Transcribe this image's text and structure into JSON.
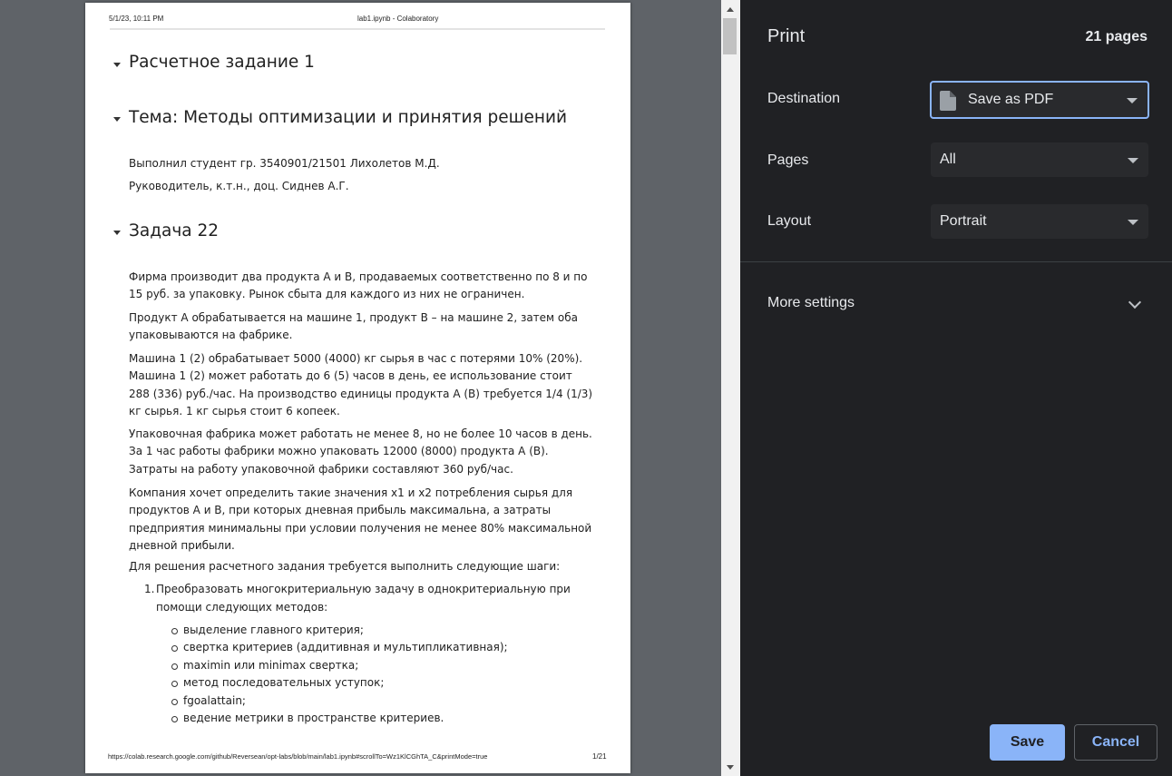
{
  "document": {
    "header_date": "5/1/23, 10:11 PM",
    "header_title": "lab1.ipynb - Colaboratory",
    "heading1": "Расчетное задание 1",
    "heading2": "Тема: Методы оптимизации и принятия решений",
    "author": "Выполнил студент гр. 3540901/21501 Лихолетов М.Д.",
    "supervisor": "Руководитель, к.т.н., доц. Сиднев А.Г.",
    "heading3": "Задача 22",
    "paragraphs": [
      "Фирма производит два продукта А и В, продаваемых соответственно по 8 и по 15 руб. за упаковку. Рынок сбыта для каждого из них не ограничен.",
      "Продукт А обрабатывается на машине 1, продукт В – на машине 2, затем оба упаковываются на фабрике.",
      "Машина 1 (2) обрабатывает 5000 (4000) кг сырья в час с потерями 10% (20%). Машина 1 (2) может работать до 6 (5) часов в день, ее использование стоит 288 (336) руб./час. На производство единицы продукта А (В) требуется 1/4 (1/3) кг сырья. 1 кг сырья стоит 6 копеек.",
      "Упаковочная фабрика может работать не менее 8, но не более 10 часов в день. За 1 час работы фабрики можно упаковать 12000 (8000) продукта А (В). Затраты на работу упаковочной фабрики составляют 360 руб/час.",
      "Компания хочет определить такие значения x1 и x2 потребления сырья для продуктов А и В, при которых дневная прибыль максимальна, а затраты предприятия минимальны при условии получения не менее 80% максимальной дневной прибыли."
    ],
    "steps_intro": "Для решения расчетного задания требуется выполнить следующие шаги:",
    "step1_num": "1.",
    "step1": "Преобразовать многокритериальную задачу в однокритериальную при помощи следующих методов:",
    "bullets": [
      "выделение главного критерия;",
      "свертка критериев (аддитивная и мультипликативная);",
      "maximin или minimax свертка;",
      "метод последовательных уступок;",
      "fgoalattain;",
      "ведение метрики в пространстве критериев."
    ],
    "footer_url": "https://colab.research.google.com/github/Reversean/opt-labs/blob/main/lab1.ipynb#scrollTo=Wz1KlCGhTA_C&printMode=true",
    "footer_page": "1/21"
  },
  "print_panel": {
    "title": "Print",
    "pages_count": "21 pages",
    "destination_label": "Destination",
    "destination_value": "Save as PDF",
    "pages_label": "Pages",
    "pages_value": "All",
    "layout_label": "Layout",
    "layout_value": "Portrait",
    "more_settings": "More settings",
    "save_label": "Save",
    "cancel_label": "Cancel"
  },
  "colors": {
    "panel_bg": "#202124",
    "accent": "#8ab4f8",
    "select_bg": "#292a2d"
  },
  "icons": [
    "pdf-file-icon",
    "dropdown-caret-icon",
    "chevron-down-icon",
    "collapse-triangle-icon"
  ]
}
